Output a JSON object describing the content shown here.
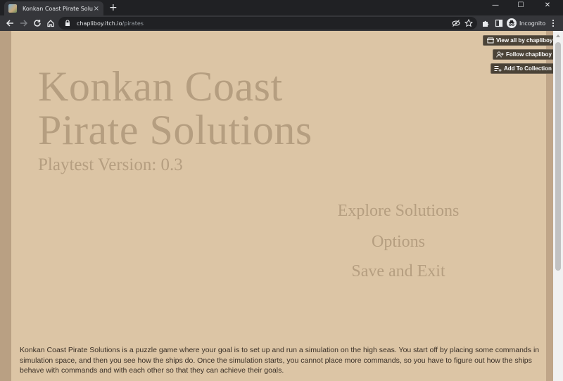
{
  "browser": {
    "tab_title": "Konkan Coast Pirate Solutions (p",
    "tab_close": "×",
    "new_tab": "+",
    "url_host": "chapliboy.itch.io",
    "url_path": "/pirates",
    "incognito_label": "Incognito",
    "window_controls": {
      "minimize": "—",
      "maximize": "☐",
      "close": "✕"
    }
  },
  "itch": {
    "view_all": "View all by chapliboy",
    "follow": "Follow chapliboy",
    "add_collection": "Add To Collection"
  },
  "game": {
    "title_line1": "Konkan Coast",
    "title_line2": "Pirate Solutions",
    "version": "Playtest Version: 0.3",
    "menu": {
      "explore": "Explore Solutions",
      "options": "Options",
      "save_exit": "Save and Exit"
    }
  },
  "description": "Konkan Coast Pirate Solutions is a puzzle game where your goal is to set up and run a simulation on the high seas. You start off by placing some commands in simulation space, and then you see how the ships do. Once the simulation starts, you cannot place more commands, so you have to figure out how the ships behave with commands and with each other so that they can achieve their goals.",
  "colors": {
    "page_bg": "#dcc5a5",
    "title_text": "#b59e80",
    "body_text": "#3b3128",
    "itch_button": "#4b4337"
  }
}
